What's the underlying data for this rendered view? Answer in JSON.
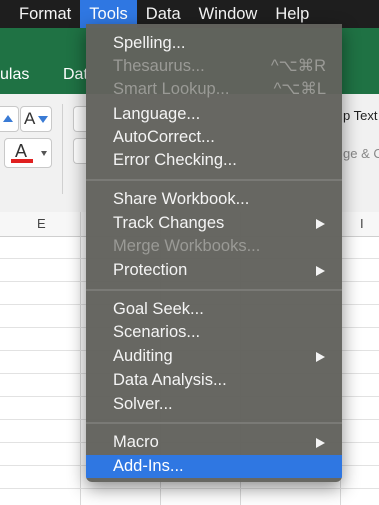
{
  "menubar": {
    "items": [
      "Format",
      "Tools",
      "Data",
      "Window",
      "Help"
    ],
    "active": "Tools"
  },
  "ribbon": {
    "tabs": [
      "ulas",
      "Dat"
    ],
    "font_color_label": "A",
    "wrap_text_label": "p Text",
    "merge_label": "ge & C"
  },
  "sheet": {
    "columns": [
      "E",
      "I"
    ]
  },
  "tools_menu": {
    "items": [
      {
        "label": "Spelling...",
        "shortcut": "",
        "submenu": false,
        "enabled": true
      },
      {
        "label": "Thesaurus...",
        "shortcut": "^⌥⌘R",
        "submenu": false,
        "enabled": false
      },
      {
        "label": "Smart Lookup...",
        "shortcut": "^⌥⌘L",
        "submenu": false,
        "enabled": false
      },
      {
        "label": "Language...",
        "shortcut": "",
        "submenu": false,
        "enabled": true
      },
      {
        "label": "AutoCorrect...",
        "shortcut": "",
        "submenu": false,
        "enabled": true
      },
      {
        "label": "Error Checking...",
        "shortcut": "",
        "submenu": false,
        "enabled": true
      },
      {
        "label": "Share Workbook...",
        "shortcut": "",
        "submenu": false,
        "enabled": true
      },
      {
        "label": "Track Changes",
        "shortcut": "",
        "submenu": true,
        "enabled": true
      },
      {
        "label": "Merge Workbooks...",
        "shortcut": "",
        "submenu": false,
        "enabled": false
      },
      {
        "label": "Protection",
        "shortcut": "",
        "submenu": true,
        "enabled": true
      },
      {
        "label": "Goal Seek...",
        "shortcut": "",
        "submenu": false,
        "enabled": true
      },
      {
        "label": "Scenarios...",
        "shortcut": "",
        "submenu": false,
        "enabled": true
      },
      {
        "label": "Auditing",
        "shortcut": "",
        "submenu": true,
        "enabled": true
      },
      {
        "label": "Data Analysis...",
        "shortcut": "",
        "submenu": false,
        "enabled": true
      },
      {
        "label": "Solver...",
        "shortcut": "",
        "submenu": false,
        "enabled": true
      },
      {
        "label": "Macro",
        "shortcut": "",
        "submenu": true,
        "enabled": true
      },
      {
        "label": "Add-Ins...",
        "shortcut": "",
        "submenu": false,
        "enabled": true,
        "highlighted": true
      }
    ]
  },
  "colors": {
    "highlight": "#2f77e2",
    "ribbon_green": "#1f7244",
    "font_color_bar": "#e02020"
  }
}
